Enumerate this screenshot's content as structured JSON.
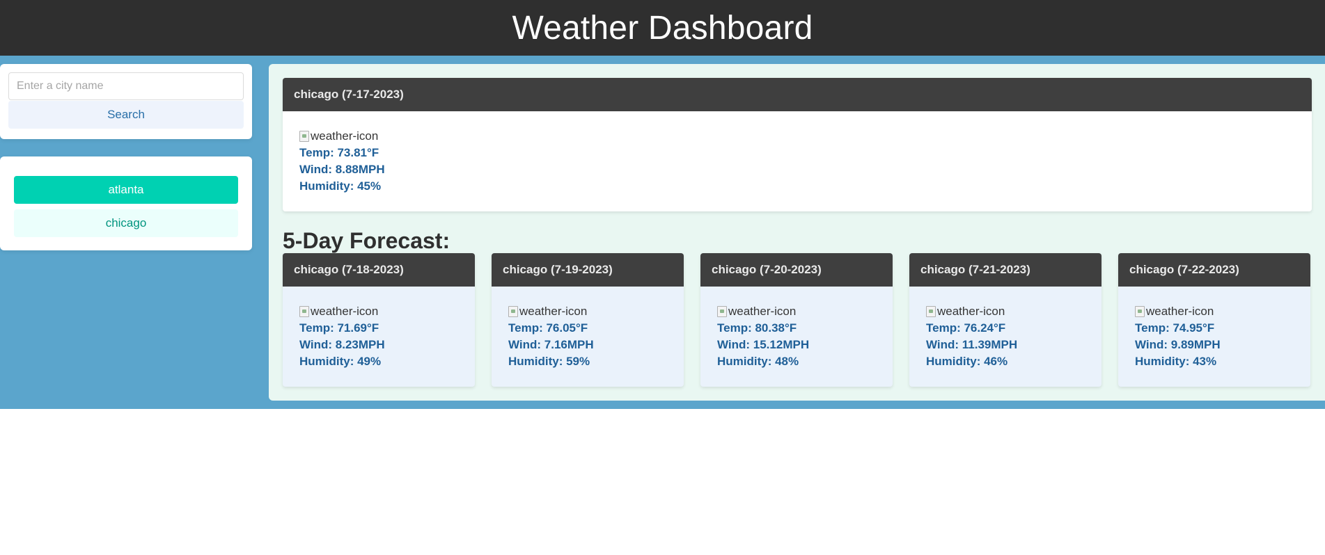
{
  "header": {
    "title": "Weather Dashboard"
  },
  "search": {
    "placeholder": "Enter a city name",
    "button_label": "Search"
  },
  "history": {
    "items": [
      {
        "label": "atlanta"
      },
      {
        "label": "chicago"
      }
    ]
  },
  "current": {
    "title": "chicago (7-17-2023)",
    "icon_alt": "weather-icon",
    "temp": "Temp: 73.81°F",
    "wind": "Wind: 8.88MPH",
    "humidity": "Humidity: 45%"
  },
  "forecast": {
    "heading": "5-Day Forecast:",
    "days": [
      {
        "title": "chicago (7-18-2023)",
        "icon_alt": "weather-icon",
        "temp": "Temp: 71.69°F",
        "wind": "Wind: 8.23MPH",
        "humidity": "Humidity: 49%"
      },
      {
        "title": "chicago (7-19-2023)",
        "icon_alt": "weather-icon",
        "temp": "Temp: 76.05°F",
        "wind": "Wind: 7.16MPH",
        "humidity": "Humidity: 59%"
      },
      {
        "title": "chicago (7-20-2023)",
        "icon_alt": "weather-icon",
        "temp": "Temp: 80.38°F",
        "wind": "Wind: 15.12MPH",
        "humidity": "Humidity: 48%"
      },
      {
        "title": "chicago (7-21-2023)",
        "icon_alt": "weather-icon",
        "temp": "Temp: 76.24°F",
        "wind": "Wind: 11.39MPH",
        "humidity": "Humidity: 46%"
      },
      {
        "title": "chicago (7-22-2023)",
        "icon_alt": "weather-icon",
        "temp": "Temp: 74.95°F",
        "wind": "Wind: 9.89MPH",
        "humidity": "Humidity: 43%"
      }
    ]
  },
  "colors": {
    "header_bg": "#2f2f2f",
    "band_bg": "#5ba5cc",
    "panel_bg": "#e9f7f2",
    "card_header_bg": "#3f3f3f",
    "accent_primary": "#00d1b2",
    "stat_text": "#1f5f97"
  }
}
